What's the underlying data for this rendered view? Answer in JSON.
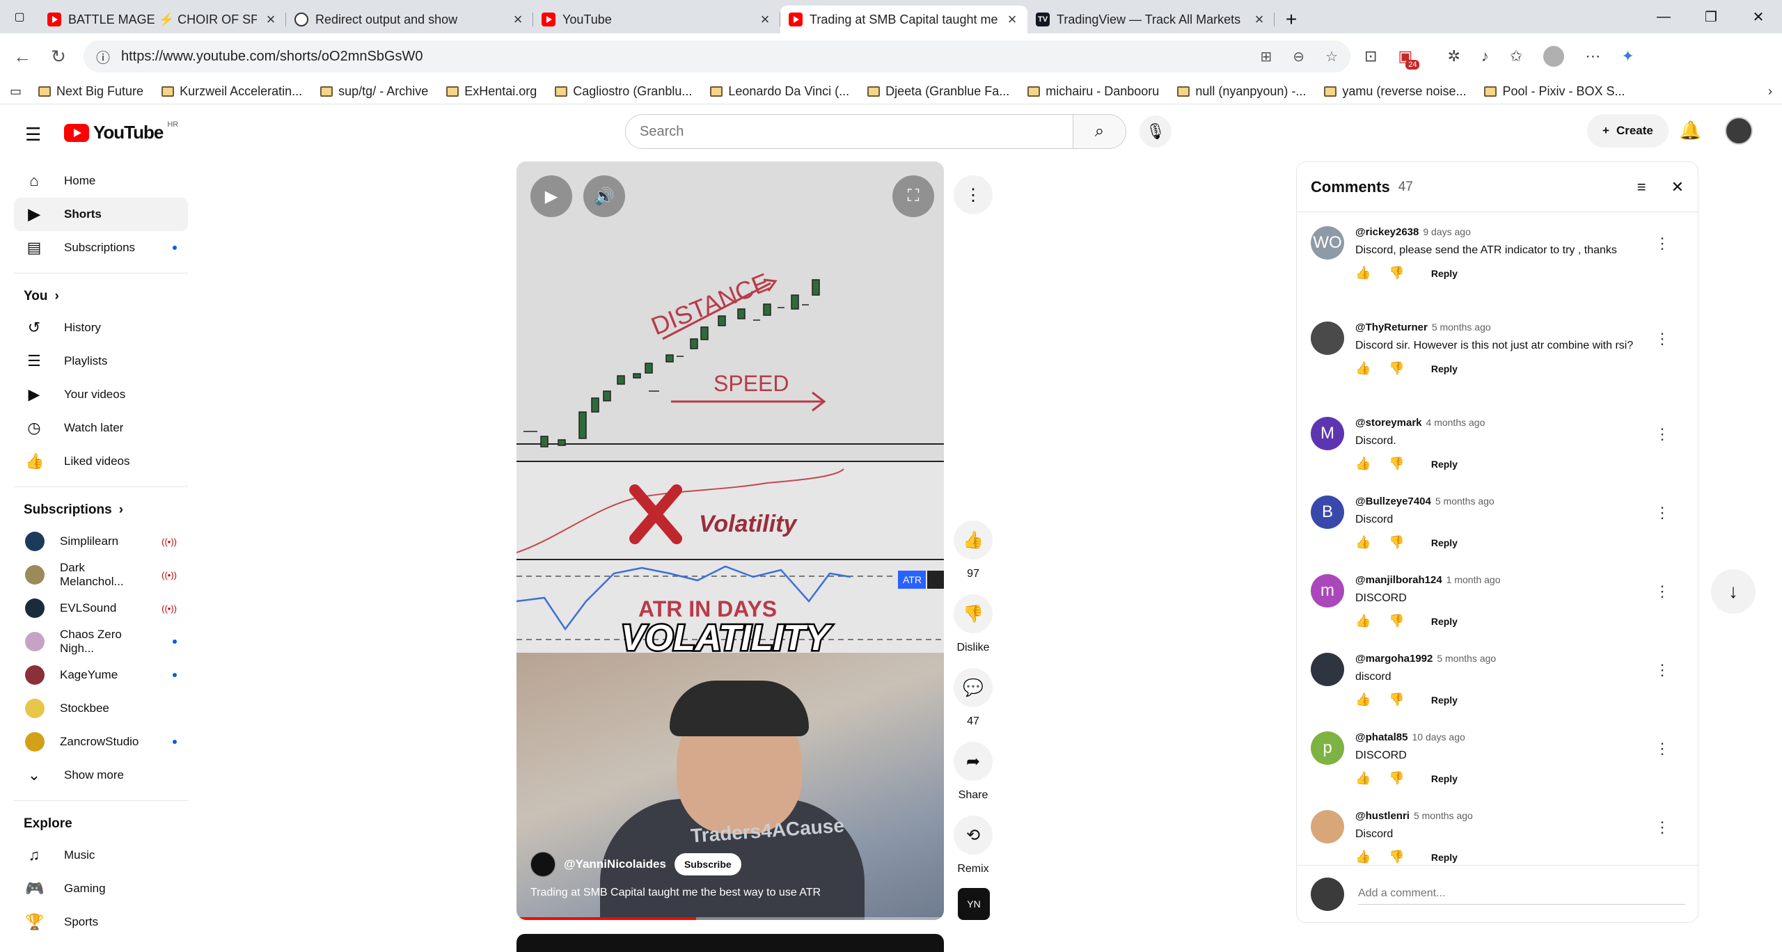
{
  "browser": {
    "tabs": [
      {
        "title": "BATTLE MAGE ⚡ CHOIR OF SPELL",
        "favicon": "youtube-icon",
        "active": false
      },
      {
        "title": "Redirect output and show",
        "favicon": "chatgpt-icon",
        "active": false
      },
      {
        "title": "YouTube",
        "favicon": "youtube-icon",
        "active": false
      },
      {
        "title": "Trading at SMB Capital taught me",
        "favicon": "youtube-icon",
        "active": true
      },
      {
        "title": "TradingView — Track All Markets",
        "favicon": "tradingview-icon",
        "active": false
      }
    ],
    "url": "https://www.youtube.com/shorts/oO2mnSbGsW0",
    "extension_badge": "24",
    "bookmarks": [
      {
        "label": "Next Big Future"
      },
      {
        "label": "Kurzweil Acceleratin..."
      },
      {
        "label": "sup/tg/ - Archive"
      },
      {
        "label": "ExHentai.org"
      },
      {
        "label": "Cagliostro (Granblu..."
      },
      {
        "label": "Leonardo Da Vinci (..."
      },
      {
        "label": "Djeeta (Granblue Fa..."
      },
      {
        "label": "michairu - Danbooru"
      },
      {
        "label": "null (nyanpyoun) -..."
      },
      {
        "label": "yamu (reverse noise..."
      },
      {
        "label": "Pool - Pixiv - BOX S..."
      }
    ]
  },
  "youtube": {
    "logo_text": "YouTube",
    "region": "HR",
    "search_placeholder": "Search",
    "create_label": "Create"
  },
  "sidebar": {
    "main": [
      {
        "label": "Home",
        "icon": "home-icon"
      },
      {
        "label": "Shorts",
        "icon": "shorts-icon",
        "active": true
      },
      {
        "label": "Subscriptions",
        "icon": "subscriptions-icon",
        "dot": true
      }
    ],
    "you_header": "You",
    "you": [
      {
        "label": "History",
        "icon": "history-icon"
      },
      {
        "label": "Playlists",
        "icon": "playlists-icon"
      },
      {
        "label": "Your videos",
        "icon": "your-videos-icon"
      },
      {
        "label": "Watch later",
        "icon": "watch-later-icon"
      },
      {
        "label": "Liked videos",
        "icon": "liked-videos-icon"
      }
    ],
    "subs_header": "Subscriptions",
    "subs": [
      {
        "label": "Simplilearn",
        "color": "#1b3b5a",
        "live": true
      },
      {
        "label": "Dark Melanchol...",
        "color": "#9b8a5a",
        "live": true
      },
      {
        "label": "EVLSound",
        "color": "#1a2b3c",
        "live": true
      },
      {
        "label": "Chaos Zero Nigh...",
        "color": "#c6a3c4",
        "dot": true
      },
      {
        "label": "KageYume",
        "color": "#8b2f3a",
        "dot": true
      },
      {
        "label": "Stockbee",
        "color": "#e8c64a"
      },
      {
        "label": "ZancrowStudio",
        "color": "#d4a017",
        "dot": true
      }
    ],
    "show_more": "Show more",
    "explore_header": "Explore",
    "explore": [
      {
        "label": "Music",
        "icon": "music-icon"
      },
      {
        "label": "Gaming",
        "icon": "gaming-icon"
      },
      {
        "label": "Sports",
        "icon": "sports-icon"
      }
    ]
  },
  "video": {
    "channel": "@YanniNicolaides",
    "subscribe": "Subscribe",
    "title": "Trading at SMB Capital taught me the best way to use ATR",
    "overlay_texts": [
      "DISTANCE",
      "SPEED",
      "Volatility",
      "ATR IN DAYS",
      "VOLATILITY",
      "ATR"
    ],
    "shirt_text": "Traders4ACause",
    "progress_fraction": 0.42
  },
  "actions": {
    "like_count": "97",
    "dislike_label": "Dislike",
    "comment_count": "47",
    "share_label": "Share",
    "remix_label": "Remix"
  },
  "comments": {
    "title": "Comments",
    "count": "47",
    "add_placeholder": "Add a comment...",
    "reply_label": "Reply",
    "items": [
      {
        "user": "@rickey2638",
        "date": "9 days ago",
        "text": "Discord, please send the ATR indicator to try , thanks",
        "avatar_letter": "WO",
        "avatar_color": "#8e9aa6"
      },
      {
        "user": "@ThyReturner",
        "date": "5 months ago",
        "text": "Discord sir. However is this not just atr combine with rsi?",
        "avatar_letter": "",
        "avatar_color": "#4a4a4a"
      },
      {
        "user": "@storeymark",
        "date": "4 months ago",
        "text": "Discord.",
        "avatar_letter": "M",
        "avatar_color": "#5e35b1"
      },
      {
        "user": "@Bullzeye7404",
        "date": "5 months ago",
        "text": "Discord",
        "avatar_letter": "B",
        "avatar_color": "#3949ab"
      },
      {
        "user": "@manjilborah124",
        "date": "1 month ago",
        "text": "DISCORD",
        "avatar_letter": "m",
        "avatar_color": "#ab47bc"
      },
      {
        "user": "@margoha1992",
        "date": "5 months ago",
        "text": "discord",
        "avatar_letter": "",
        "avatar_color": "#2f3540"
      },
      {
        "user": "@phatal85",
        "date": "10 days ago",
        "text": "DISCORD",
        "avatar_letter": "p",
        "avatar_color": "#7cb342"
      },
      {
        "user": "@hustlenri",
        "date": "5 months ago",
        "text": "Discord",
        "avatar_letter": "",
        "avatar_color": "#d9a679"
      }
    ]
  }
}
